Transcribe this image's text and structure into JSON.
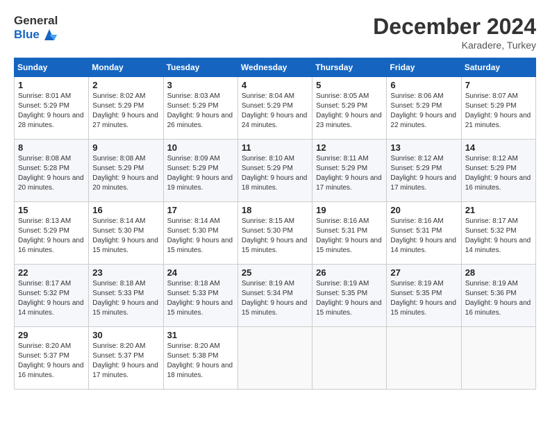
{
  "header": {
    "logo_line1": "General",
    "logo_line2": "Blue",
    "month_title": "December 2024",
    "subtitle": "Karadere, Turkey"
  },
  "weekdays": [
    "Sunday",
    "Monday",
    "Tuesday",
    "Wednesday",
    "Thursday",
    "Friday",
    "Saturday"
  ],
  "weeks": [
    [
      {
        "day": "1",
        "sunrise": "8:01 AM",
        "sunset": "5:29 PM",
        "daylight": "9 hours and 28 minutes."
      },
      {
        "day": "2",
        "sunrise": "8:02 AM",
        "sunset": "5:29 PM",
        "daylight": "9 hours and 27 minutes."
      },
      {
        "day": "3",
        "sunrise": "8:03 AM",
        "sunset": "5:29 PM",
        "daylight": "9 hours and 26 minutes."
      },
      {
        "day": "4",
        "sunrise": "8:04 AM",
        "sunset": "5:29 PM",
        "daylight": "9 hours and 24 minutes."
      },
      {
        "day": "5",
        "sunrise": "8:05 AM",
        "sunset": "5:29 PM",
        "daylight": "9 hours and 23 minutes."
      },
      {
        "day": "6",
        "sunrise": "8:06 AM",
        "sunset": "5:29 PM",
        "daylight": "9 hours and 22 minutes."
      },
      {
        "day": "7",
        "sunrise": "8:07 AM",
        "sunset": "5:29 PM",
        "daylight": "9 hours and 21 minutes."
      }
    ],
    [
      {
        "day": "8",
        "sunrise": "8:08 AM",
        "sunset": "5:28 PM",
        "daylight": "9 hours and 20 minutes."
      },
      {
        "day": "9",
        "sunrise": "8:08 AM",
        "sunset": "5:29 PM",
        "daylight": "9 hours and 20 minutes."
      },
      {
        "day": "10",
        "sunrise": "8:09 AM",
        "sunset": "5:29 PM",
        "daylight": "9 hours and 19 minutes."
      },
      {
        "day": "11",
        "sunrise": "8:10 AM",
        "sunset": "5:29 PM",
        "daylight": "9 hours and 18 minutes."
      },
      {
        "day": "12",
        "sunrise": "8:11 AM",
        "sunset": "5:29 PM",
        "daylight": "9 hours and 17 minutes."
      },
      {
        "day": "13",
        "sunrise": "8:12 AM",
        "sunset": "5:29 PM",
        "daylight": "9 hours and 17 minutes."
      },
      {
        "day": "14",
        "sunrise": "8:12 AM",
        "sunset": "5:29 PM",
        "daylight": "9 hours and 16 minutes."
      }
    ],
    [
      {
        "day": "15",
        "sunrise": "8:13 AM",
        "sunset": "5:29 PM",
        "daylight": "9 hours and 16 minutes."
      },
      {
        "day": "16",
        "sunrise": "8:14 AM",
        "sunset": "5:30 PM",
        "daylight": "9 hours and 15 minutes."
      },
      {
        "day": "17",
        "sunrise": "8:14 AM",
        "sunset": "5:30 PM",
        "daylight": "9 hours and 15 minutes."
      },
      {
        "day": "18",
        "sunrise": "8:15 AM",
        "sunset": "5:30 PM",
        "daylight": "9 hours and 15 minutes."
      },
      {
        "day": "19",
        "sunrise": "8:16 AM",
        "sunset": "5:31 PM",
        "daylight": "9 hours and 15 minutes."
      },
      {
        "day": "20",
        "sunrise": "8:16 AM",
        "sunset": "5:31 PM",
        "daylight": "9 hours and 14 minutes."
      },
      {
        "day": "21",
        "sunrise": "8:17 AM",
        "sunset": "5:32 PM",
        "daylight": "9 hours and 14 minutes."
      }
    ],
    [
      {
        "day": "22",
        "sunrise": "8:17 AM",
        "sunset": "5:32 PM",
        "daylight": "9 hours and 14 minutes."
      },
      {
        "day": "23",
        "sunrise": "8:18 AM",
        "sunset": "5:33 PM",
        "daylight": "9 hours and 15 minutes."
      },
      {
        "day": "24",
        "sunrise": "8:18 AM",
        "sunset": "5:33 PM",
        "daylight": "9 hours and 15 minutes."
      },
      {
        "day": "25",
        "sunrise": "8:19 AM",
        "sunset": "5:34 PM",
        "daylight": "9 hours and 15 minutes."
      },
      {
        "day": "26",
        "sunrise": "8:19 AM",
        "sunset": "5:35 PM",
        "daylight": "9 hours and 15 minutes."
      },
      {
        "day": "27",
        "sunrise": "8:19 AM",
        "sunset": "5:35 PM",
        "daylight": "9 hours and 15 minutes."
      },
      {
        "day": "28",
        "sunrise": "8:19 AM",
        "sunset": "5:36 PM",
        "daylight": "9 hours and 16 minutes."
      }
    ],
    [
      {
        "day": "29",
        "sunrise": "8:20 AM",
        "sunset": "5:37 PM",
        "daylight": "9 hours and 16 minutes."
      },
      {
        "day": "30",
        "sunrise": "8:20 AM",
        "sunset": "5:37 PM",
        "daylight": "9 hours and 17 minutes."
      },
      {
        "day": "31",
        "sunrise": "8:20 AM",
        "sunset": "5:38 PM",
        "daylight": "9 hours and 18 minutes."
      },
      null,
      null,
      null,
      null
    ]
  ],
  "labels": {
    "sunrise": "Sunrise: ",
    "sunset": "Sunset: ",
    "daylight": "Daylight: "
  }
}
